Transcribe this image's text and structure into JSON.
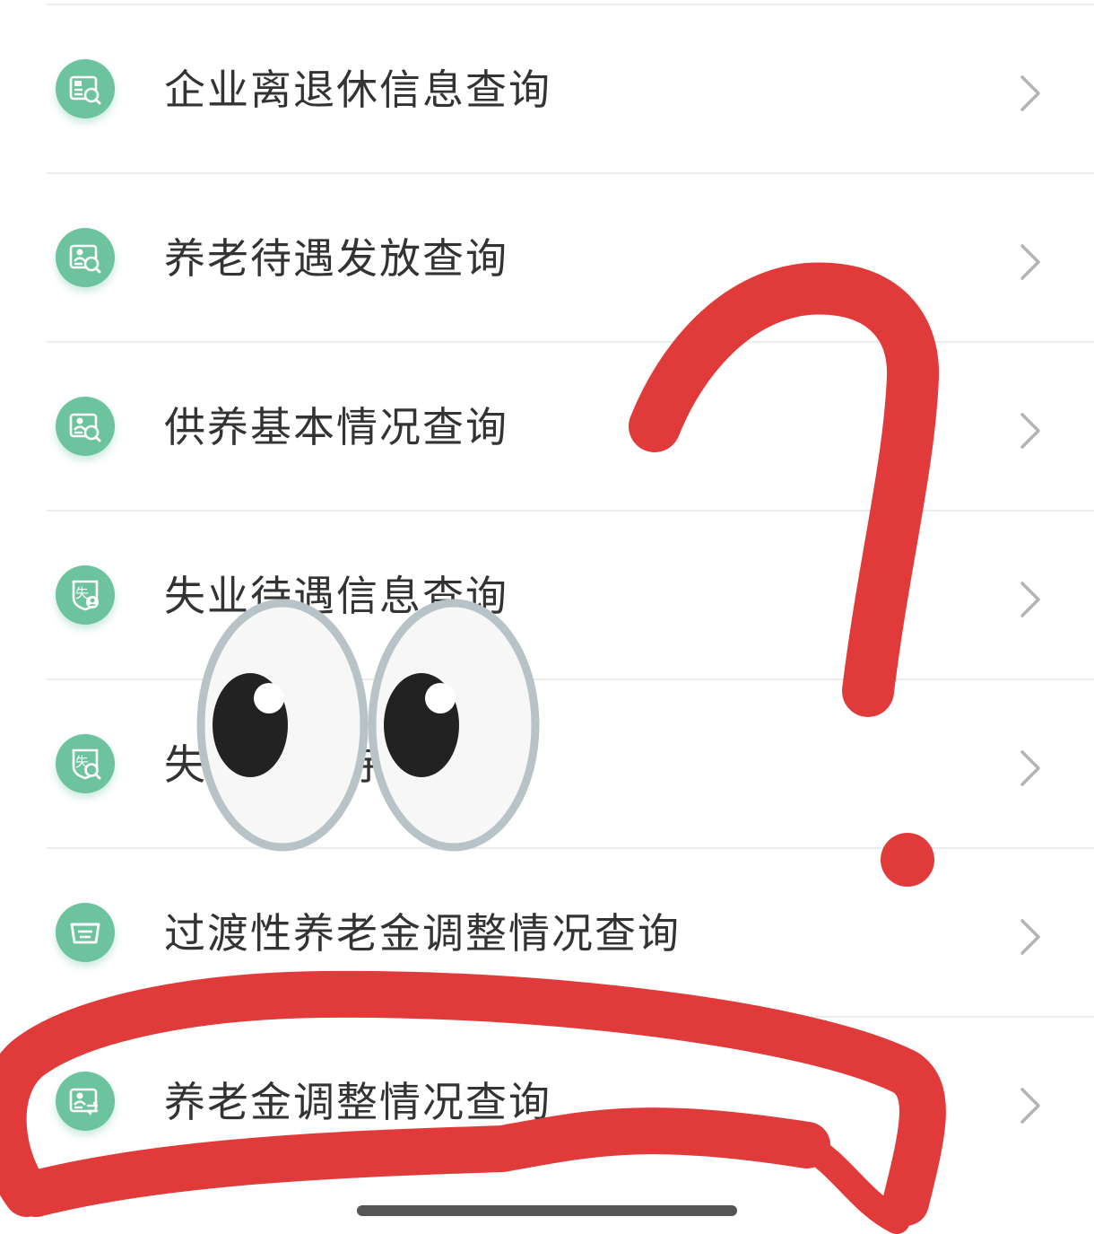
{
  "menu": {
    "items": [
      {
        "label": "企业离退休信息查询",
        "icon": "retirement-info-search-icon"
      },
      {
        "label": "养老待遇发放查询",
        "icon": "pension-payment-search-icon"
      },
      {
        "label": "供养基本情况查询",
        "icon": "dependent-support-search-icon"
      },
      {
        "label": "失业待遇信息查询",
        "icon": "unemployment-benefit-icon"
      },
      {
        "label": "失业保险待遇查询",
        "icon": "unemployment-search-icon"
      },
      {
        "label": "过渡性养老金调整情况查询",
        "icon": "tray-icon"
      },
      {
        "label": "养老金调整情况查询",
        "icon": "pension-adjustment-icon"
      }
    ]
  },
  "colors": {
    "icon_bg": "#6cc39d",
    "label_text": "#333333",
    "divider": "#ececec",
    "chevron": "#b3b3b3",
    "annotation_red": "#e03b3a",
    "eye_white": "#f7f7f7",
    "eye_outline": "#b8c3c8",
    "pupil": "#222222"
  },
  "annotations": {
    "question_mark": "red-question-mark-icon",
    "eyes": "eyes-emoji-icon",
    "circle": "red-circle-marker-icon"
  }
}
